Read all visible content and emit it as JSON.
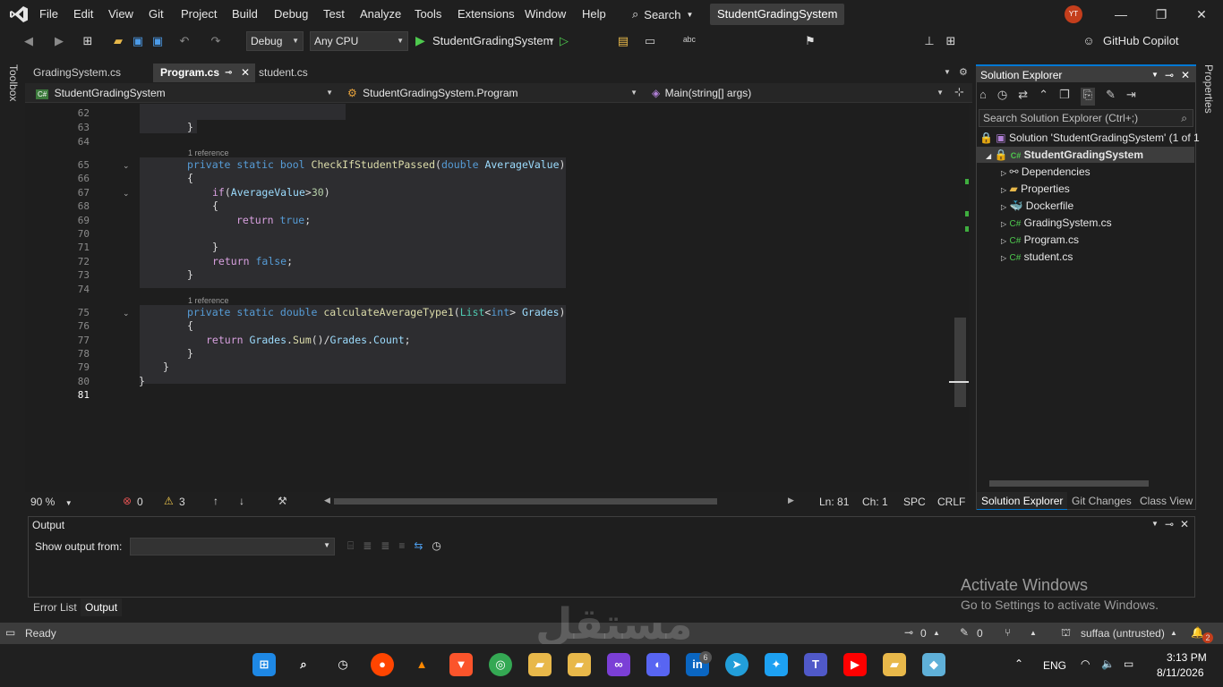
{
  "menubar": {
    "items": [
      "File",
      "Edit",
      "View",
      "Git",
      "Project",
      "Build",
      "Debug",
      "Test",
      "Analyze",
      "Tools",
      "Extensions",
      "Window",
      "Help"
    ],
    "search_label": "Search",
    "solution_title": "StudentGradingSystem",
    "avatar_initials": "YT"
  },
  "toolbar": {
    "config": "Debug",
    "platform": "Any CPU",
    "run_target": "StudentGradingSystem",
    "copilot": "GitHub Copilot"
  },
  "toolbox_label": "Toolbox",
  "properties_label": "Properties",
  "tabs": [
    "GradingSystem.cs",
    "Program.cs",
    "student.cs"
  ],
  "navbar": {
    "project": "StudentGradingSystem",
    "class": "StudentGradingSystem.Program",
    "member": "Main(string[] args)"
  },
  "editor": {
    "reference_label": "1 reference",
    "line_numbers": [
      "62",
      "63",
      "64",
      "65",
      "66",
      "67",
      "68",
      "69",
      "70",
      "71",
      "72",
      "73",
      "74",
      "75",
      "76",
      "77",
      "78",
      "79",
      "80",
      "81"
    ]
  },
  "editor_status": {
    "zoom": "90 %",
    "errors": "0",
    "warnings": "3",
    "line": "Ln: 81",
    "col": "Ch: 1",
    "spacing": "SPC",
    "eol": "CRLF"
  },
  "solution_explorer": {
    "title": "Solution Explorer",
    "search_placeholder": "Search Solution Explorer (Ctrl+;)",
    "solution": "Solution 'StudentGradingSystem' (1 of 1",
    "project": "StudentGradingSystem",
    "items": [
      "Dependencies",
      "Properties",
      "Dockerfile",
      "GradingSystem.cs",
      "Program.cs",
      "student.cs"
    ],
    "bottom_tabs": [
      "Solution Explorer",
      "Git Changes",
      "Class View"
    ]
  },
  "output": {
    "title": "Output",
    "show_from_label": "Show output from:"
  },
  "bottom_tabs": [
    "Error List",
    "Output"
  ],
  "activation": {
    "line1": "Activate Windows",
    "line2": "Go to Settings to activate Windows."
  },
  "statusbar": {
    "ready": "Ready",
    "up_count": "0",
    "edit_count": "0",
    "user": "suffaa (untrusted)",
    "notification_count": "2"
  },
  "taskbar": {
    "language": "ENG",
    "time": "3:13 PM",
    "date": "8/11/2026",
    "linkedin_badge": "6"
  },
  "watermark": "مستقل"
}
